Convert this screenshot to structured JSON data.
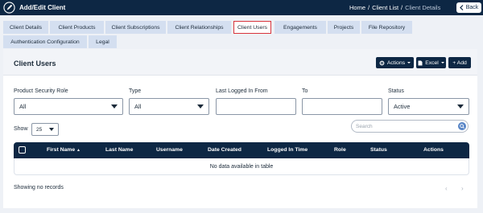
{
  "header": {
    "title": "Add/Edit Client",
    "breadcrumb": {
      "home": "Home",
      "sep": "/",
      "list": "Client List",
      "current": "Client Details"
    },
    "back_label": "Back",
    "back_icon": "chevron-left-icon"
  },
  "tabs": [
    {
      "label": "Client Details"
    },
    {
      "label": "Client Products"
    },
    {
      "label": "Client Subscriptions"
    },
    {
      "label": "Client Relationships"
    },
    {
      "label": "Client Users",
      "active": true
    },
    {
      "label": "Engagements"
    },
    {
      "label": "Projects"
    },
    {
      "label": "File Repository"
    },
    {
      "label": "Authentication Configuration"
    },
    {
      "label": "Legal"
    }
  ],
  "panel": {
    "title": "Client Users",
    "actions_label": "Actions",
    "excel_label": "Excel",
    "add_label": "+ Add"
  },
  "filters": {
    "product_security_role": {
      "label": "Product Security Role",
      "value": "All"
    },
    "type": {
      "label": "Type",
      "value": "All"
    },
    "last_logged_in_from": {
      "label": "Last Logged In From",
      "value": ""
    },
    "to": {
      "label": "To",
      "value": ""
    },
    "status": {
      "label": "Status",
      "value": "Active"
    }
  },
  "list_controls": {
    "show_label": "Show",
    "page_size": "25",
    "search_placeholder": "Search"
  },
  "table": {
    "columns": [
      "First Name",
      "Last Name",
      "Username",
      "Date Created",
      "Logged In Time",
      "Role",
      "Status",
      "Actions"
    ],
    "sort_indicator": "▲",
    "empty_message": "No data available in table"
  },
  "footer": {
    "info": "Showing no records",
    "prev": "‹",
    "next": "›"
  },
  "colors": {
    "navy": "#0d2744",
    "tab_bg": "#d4dff0",
    "active_tab_border": "#d8343b",
    "search_icon": "#5b87c7"
  }
}
